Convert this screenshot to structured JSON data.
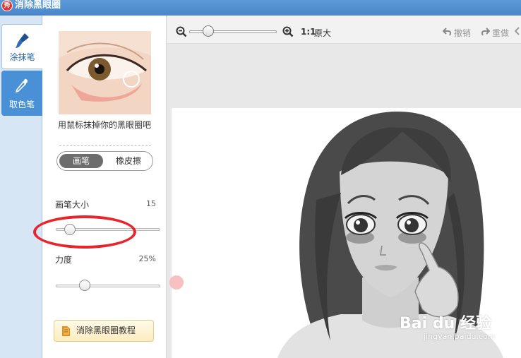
{
  "window": {
    "title": "消除黑眼圈",
    "logo_text": "秀"
  },
  "rail": {
    "tabs": [
      {
        "label": "涂抹笔",
        "icon": "brush-icon",
        "active": true
      },
      {
        "label": "取色笔",
        "icon": "eyedropper-icon",
        "active": false
      }
    ]
  },
  "panel": {
    "hint": "用鼠标抹掉你的黑眼圈吧",
    "mode": {
      "brush_label": "画笔",
      "eraser_label": "橡皮擦",
      "selected": "画笔"
    },
    "brush_size": {
      "label": "画笔大小",
      "value": "15",
      "fraction": 0.09
    },
    "strength": {
      "label": "力度",
      "value": "25%",
      "fraction": 0.25
    },
    "tutorial_label": "消除黑眼圈教程"
  },
  "toolbar": {
    "zoom_fraction": 0.18,
    "zoom_ratio": "1:1",
    "original_size_label": "原大",
    "undo_label": "撤销",
    "redo_label": "重做"
  },
  "watermark": {
    "text": "Bai du 经验",
    "url": "jingyan.baidu.com"
  },
  "colors": {
    "titlebar": "#4a86c8",
    "rail_bg": "#d6e6f5",
    "active_tab": "#4a90d6",
    "highlight_ellipse": "#e8252a",
    "pink_brush_dot": "#f6b6b8"
  }
}
